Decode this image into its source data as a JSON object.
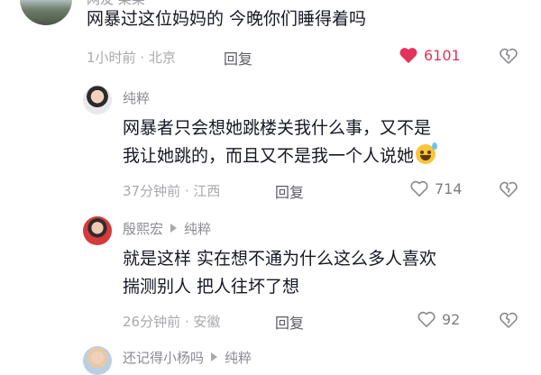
{
  "top_comment": {
    "author": "网友·某某",
    "text": "网暴过这位妈妈的 今晚你们睡得着吗",
    "time_location": "1小时前 · 北京",
    "reply_label": "回复",
    "likes": "6101",
    "liked": true
  },
  "replies": [
    {
      "author": "纯粹",
      "line1": "网暴者只会想她跳楼关我什么事，又不是",
      "line2": "我让她跳的，而且又不是我一个人说她",
      "emoji": "grinning-sweat-emoji",
      "time_location": "37分钟前 · 江西",
      "reply_label": "回复",
      "likes": "714"
    },
    {
      "author": "殷熙宏",
      "reply_to": "纯粹",
      "line1": "就是这样  实在想不通为什么这么多人喜欢",
      "line2": "揣测别人  把人往坏了想",
      "time_location": "26分钟前 · 安徽",
      "reply_label": "回复",
      "likes": "92"
    },
    {
      "author": "还记得小杨吗",
      "reply_to": "纯粹"
    }
  ],
  "colors": {
    "like_active": "#e5325a",
    "text": "#161823",
    "meta": "#a8a9ad"
  },
  "icons": [
    "heart-filled-icon",
    "heart-outline-icon",
    "dislike-heart-icon",
    "reply-arrow-icon"
  ]
}
